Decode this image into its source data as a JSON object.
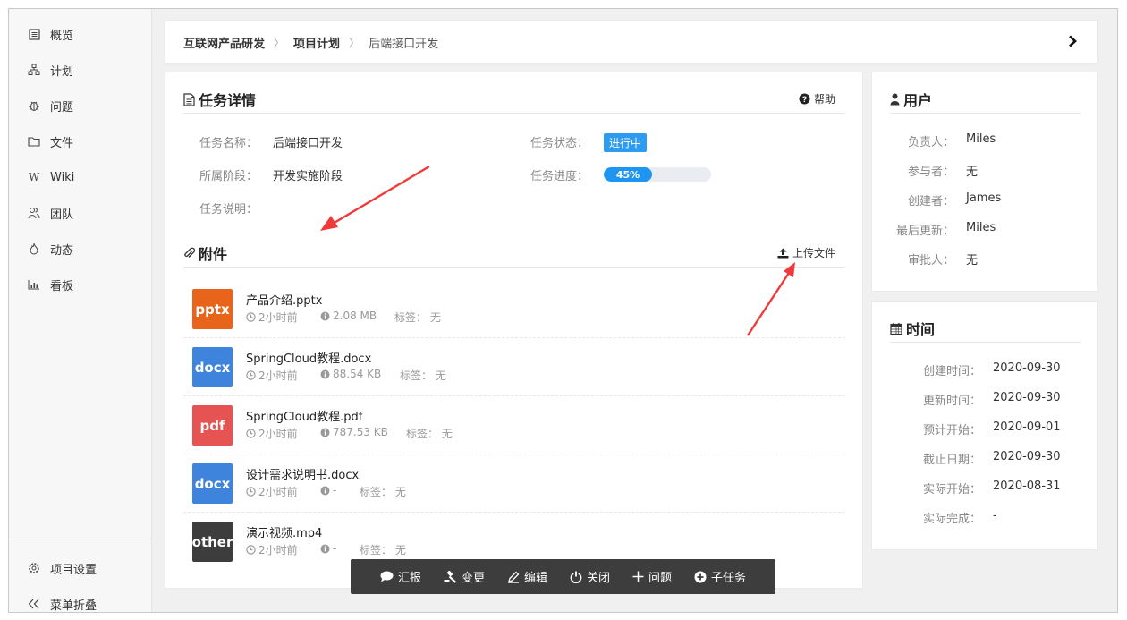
{
  "sidebar": {
    "items": [
      {
        "label": "概览",
        "icon": "overview-icon"
      },
      {
        "label": "计划",
        "icon": "plan-icon"
      },
      {
        "label": "问题",
        "icon": "bug-icon"
      },
      {
        "label": "文件",
        "icon": "folder-icon"
      },
      {
        "label": "Wiki",
        "icon": "wiki-icon"
      },
      {
        "label": "团队",
        "icon": "team-icon"
      },
      {
        "label": "动态",
        "icon": "activity-icon"
      },
      {
        "label": "看板",
        "icon": "board-icon"
      }
    ],
    "settings_label": "项目设置",
    "collapse_label": "菜单折叠"
  },
  "breadcrumb": [
    "互联网产品研发",
    "项目计划",
    "后端接口开发"
  ],
  "task": {
    "title": "任务详情",
    "help_label": "帮助",
    "name_label": "任务名称：",
    "name": "后端接口开发",
    "phase_label": "所属阶段：",
    "phase": "开发实施阶段",
    "desc_label": "任务说明：",
    "status_label": "任务状态：",
    "status": "进行中",
    "progress_label": "任务进度：",
    "progress_text": "45%",
    "progress_value": 0.45
  },
  "attachments": {
    "title": "附件",
    "upload_label": "上传文件",
    "items": [
      {
        "type": "pptx",
        "color": "#e8641b",
        "name": "产品介绍.pptx",
        "time": "2小时前",
        "size": "2.08 MB",
        "tags": "标签： 无"
      },
      {
        "type": "docx",
        "color": "#3f84dc",
        "name": "SpringCloud教程.docx",
        "time": "2小时前",
        "size": "88.54 KB",
        "tags": "标签： 无"
      },
      {
        "type": "pdf",
        "color": "#e65353",
        "name": "SpringCloud教程.pdf",
        "time": "2小时前",
        "size": "787.53 KB",
        "tags": "标签： 无"
      },
      {
        "type": "docx",
        "color": "#3f84dc",
        "name": "设计需求说明书.docx",
        "time": "2小时前",
        "size": "-",
        "tags": "标签： 无"
      },
      {
        "type": "other",
        "color": "#3d3d3d",
        "name": "演示视频.mp4",
        "time": "2小时前",
        "size": "-",
        "tags": "标签： 无"
      }
    ]
  },
  "users": {
    "title": "用户",
    "rows": [
      {
        "label": "负责人：",
        "value": "Miles"
      },
      {
        "label": "参与者：",
        "value": "无"
      },
      {
        "label": "创建者：",
        "value": "James"
      },
      {
        "label": "最后更新：",
        "value": "Miles"
      },
      {
        "label": "审批人：",
        "value": "无"
      }
    ]
  },
  "time": {
    "title": "时间",
    "rows": [
      {
        "label": "创建时间：",
        "value": "2020-09-30"
      },
      {
        "label": "更新时间：",
        "value": "2020-09-30"
      },
      {
        "label": "预计开始：",
        "value": "2020-09-01"
      },
      {
        "label": "截止日期：",
        "value": "2020-09-30"
      },
      {
        "label": "实际开始：",
        "value": "2020-08-31"
      },
      {
        "label": "实际完成：",
        "value": "-"
      }
    ]
  },
  "toolbar": {
    "buttons": [
      {
        "label": "汇报",
        "icon": "comment-icon"
      },
      {
        "label": "变更",
        "icon": "gavel-icon"
      },
      {
        "label": "编辑",
        "icon": "pencil-icon"
      },
      {
        "label": "关闭",
        "icon": "power-icon"
      },
      {
        "label": "问题",
        "icon": "plus-icon"
      },
      {
        "label": "子任务",
        "icon": "plus-circle-icon"
      }
    ]
  },
  "colors": {
    "accent": "#2d9bf0",
    "annotation": "#f03a3a",
    "toolbar": "#3d3d3d"
  }
}
